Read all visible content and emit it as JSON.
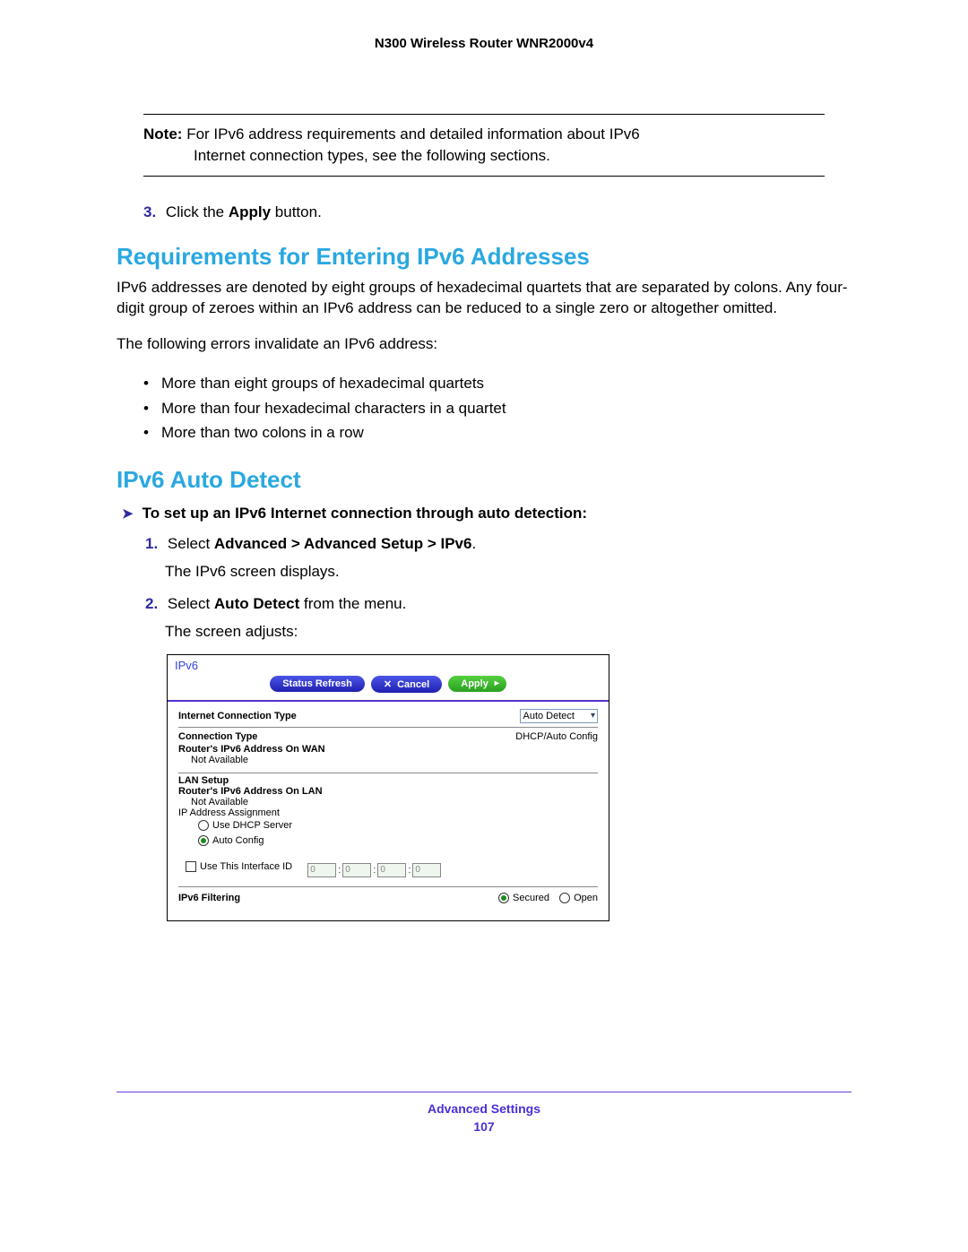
{
  "header": {
    "title": "N300 Wireless Router WNR2000v4"
  },
  "note": {
    "label": "Note:",
    "line1": "For IPv6 address requirements and detailed information about IPv6",
    "line2": "Internet connection types, see the following sections."
  },
  "step3": {
    "num": "3.",
    "pre": "Click the ",
    "bold": "Apply",
    "post": " button."
  },
  "sectionA": {
    "heading": "Requirements for Entering IPv6 Addresses",
    "p1": "IPv6 addresses are denoted by eight groups of hexadecimal quartets that are separated by colons. Any four-digit group of zeroes within an IPv6 address can be reduced to a single zero or altogether omitted.",
    "p2": "The following errors invalidate an IPv6 address:",
    "bullets": [
      "More than eight groups of hexadecimal quartets",
      "More than four hexadecimal characters in a quartet",
      "More than two colons in a row"
    ]
  },
  "sectionB": {
    "heading": "IPv6 Auto Detect",
    "pointer": "To set up an IPv6 Internet connection through auto detection:",
    "step1": {
      "num": "1.",
      "pre": "Select ",
      "bold": "Advanced > Advanced Setup > IPv6",
      "post": ".",
      "sub": "The IPv6 screen displays."
    },
    "step2": {
      "num": "2.",
      "pre": "Select ",
      "bold": "Auto Detect",
      "post": " from the menu.",
      "sub": "The screen adjusts:"
    }
  },
  "panel": {
    "title": "IPv6",
    "buttons": {
      "refresh": "Status Refresh",
      "cancel": "Cancel",
      "apply": "Apply"
    },
    "ict_label": "Internet Connection Type",
    "ict_value": "Auto Detect",
    "conn_type_label": "Connection Type",
    "conn_type_value": "DHCP/Auto Config",
    "wan_label": "Router's IPv6 Address On WAN",
    "not_available": "Not Available",
    "lan_setup": "LAN Setup",
    "lan_label": "Router's IPv6 Address On LAN",
    "ip_assign": "IP Address Assignment",
    "opt_dhcp": "Use DHCP Server",
    "opt_auto": "Auto Config",
    "use_if_id": "Use This Interface ID",
    "ifid": [
      "0",
      "0",
      "0",
      "0"
    ],
    "filter_label": "IPv6 Filtering",
    "filter_secured": "Secured",
    "filter_open": "Open"
  },
  "footer": {
    "label": "Advanced Settings",
    "page": "107"
  }
}
